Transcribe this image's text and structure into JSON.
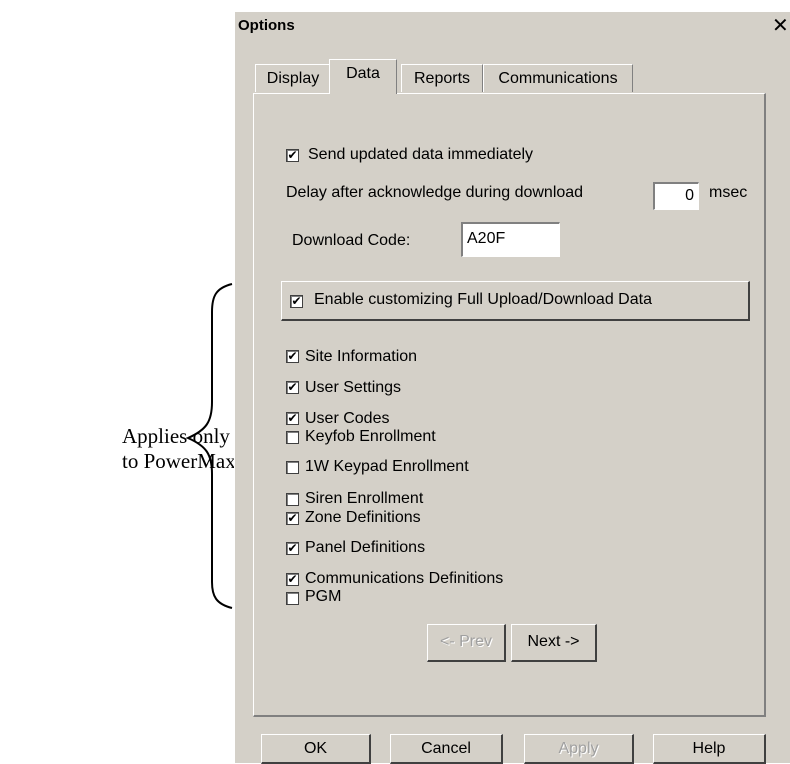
{
  "annotation": {
    "line1": "Applies only",
    "line2": "to PowerMax+"
  },
  "dialog": {
    "title": "Options",
    "close_glyph": "✕"
  },
  "tabs": [
    {
      "label": "Display",
      "active": false
    },
    {
      "label": "Data",
      "active": true
    },
    {
      "label": "Reports",
      "active": false
    },
    {
      "label": "Communications",
      "active": false
    }
  ],
  "data_tab": {
    "send_immediately": {
      "label": "Send updated data immediately",
      "checked": true
    },
    "delay": {
      "label": "Delay after acknowledge during download",
      "value": "0",
      "unit": "msec"
    },
    "download_code": {
      "label": "Download Code:",
      "value": "A20F"
    },
    "enable_customizing": {
      "label": "Enable customizing Full Upload/Download Data",
      "checked": true
    },
    "items": [
      {
        "label": "Site Information",
        "checked": true
      },
      {
        "label": "User Settings",
        "checked": true
      },
      {
        "label": "User Codes",
        "checked": true
      },
      {
        "label": "Keyfob Enrollment",
        "checked": false
      },
      {
        "label": "1W Keypad Enrollment",
        "checked": false
      },
      {
        "label": "Siren Enrollment",
        "checked": false
      },
      {
        "label": "Zone Definitions",
        "checked": true
      },
      {
        "label": "Panel Definitions",
        "checked": true
      },
      {
        "label": "Communications Definitions",
        "checked": true
      },
      {
        "label": "PGM",
        "checked": false
      }
    ],
    "prev_label": "<- Prev",
    "next_label": "Next ->"
  },
  "footer": {
    "ok": "OK",
    "cancel": "Cancel",
    "apply": "Apply",
    "help": "Help"
  },
  "colors": {
    "dialog_bg": "#d4d0c8",
    "disabled_text": "#a0a0a0"
  }
}
